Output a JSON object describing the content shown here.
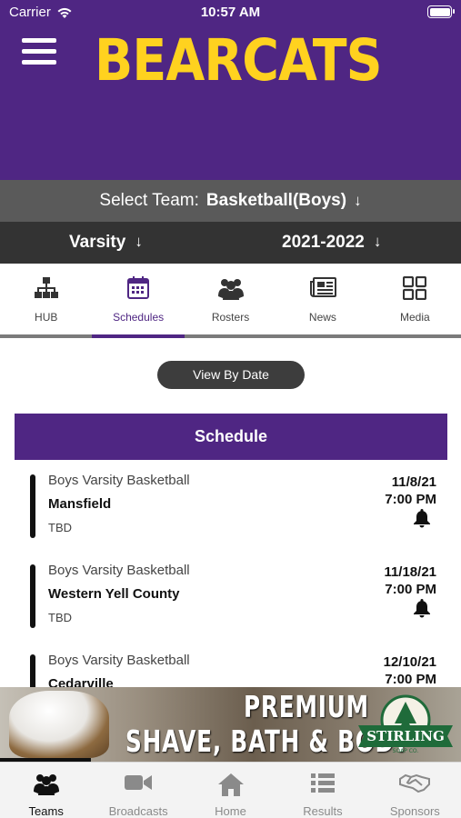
{
  "status_bar": {
    "carrier": "Carrier",
    "time": "10:57 AM"
  },
  "header": {
    "logo_text": "BEARCATS",
    "brand_color": "#4f2683",
    "accent_color": "#ffd21f"
  },
  "team_select": {
    "prefix": "Select Team:",
    "value": "Basketball(Boys)",
    "arrow": "↓"
  },
  "level_select": {
    "level": "Varsity",
    "season": "2021-2022",
    "arrow": "↓"
  },
  "tabs": [
    {
      "label": "HUB",
      "icon": "org-chart-icon"
    },
    {
      "label": "Schedules",
      "icon": "calendar-icon",
      "active": true
    },
    {
      "label": "Rosters",
      "icon": "group-icon"
    },
    {
      "label": "News",
      "icon": "newspaper-icon"
    },
    {
      "label": "Media",
      "icon": "grid-icon"
    }
  ],
  "view_by_date": "View By Date",
  "schedule_title": "Schedule",
  "games": [
    {
      "sport": "Boys Varsity Basketball",
      "opponent": "Mansfield",
      "location": "TBD",
      "date": "11/8/21",
      "time": "7:00 PM"
    },
    {
      "sport": "Boys Varsity Basketball",
      "opponent": "Western Yell County",
      "location": "TBD",
      "date": "11/18/21",
      "time": "7:00 PM"
    },
    {
      "sport": "Boys Varsity Basketball",
      "opponent": "Cedarville",
      "location": "",
      "date": "12/10/21",
      "time": "7:00 PM"
    }
  ],
  "ad": {
    "line1": "PREMIUM",
    "line2": "SHAVE, BATH & BODY",
    "brand": "STIRLING",
    "brand_sub": "SOAP CO."
  },
  "bottom_nav": [
    {
      "label": "Teams",
      "icon": "teams-icon",
      "active": true
    },
    {
      "label": "Broadcasts",
      "icon": "video-camera-icon"
    },
    {
      "label": "Home",
      "icon": "home-icon"
    },
    {
      "label": "Results",
      "icon": "list-icon"
    },
    {
      "label": "Sponsors",
      "icon": "handshake-icon"
    }
  ]
}
